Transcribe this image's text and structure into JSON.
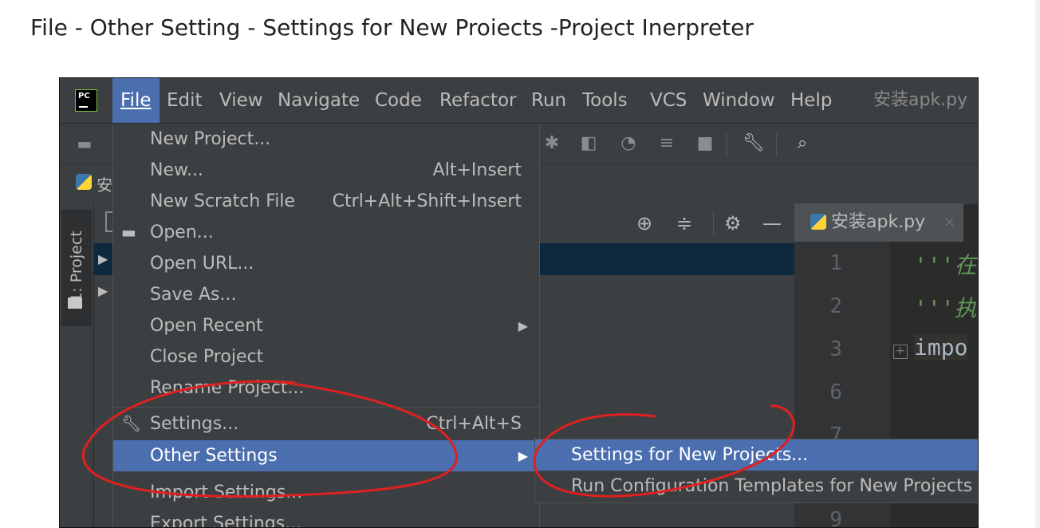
{
  "article": {
    "text": "File - Other Setting - Settings for New Proiects -Project Inerpreter"
  },
  "ide": {
    "logo_text": "PC",
    "window_title": "安装apk.py",
    "menu": [
      {
        "label": "File",
        "active": true
      },
      {
        "label": "Edit"
      },
      {
        "label": "View"
      },
      {
        "label": "Navigate"
      },
      {
        "label": "Code"
      },
      {
        "label": "Refactor"
      },
      {
        "label": "Run"
      },
      {
        "label": "Tools"
      },
      {
        "label": "VCS"
      },
      {
        "label": "Window"
      },
      {
        "label": "Help"
      }
    ],
    "nav_truncated": "安",
    "project_tab_label": "1: Project",
    "editor_tab": {
      "label": "安装apk.py",
      "close": "×"
    },
    "gutter_lines": [
      "1",
      "2",
      "3",
      "6",
      "7",
      "9"
    ],
    "fold_marker": "+",
    "code_lines": [
      "'''在",
      "'''执",
      "impo"
    ],
    "icons": {
      "toolbar": [
        "debug-icon",
        "coverage-icon",
        "profile-icon",
        "concurrency-icon",
        "stop-icon",
        "wrench-icon",
        "search-icon"
      ],
      "panel": [
        "crosshair-icon",
        "collapse-icon",
        "gear-icon",
        "minimize-icon"
      ]
    }
  },
  "file_menu": [
    {
      "label": "New Project...",
      "shortcut": ""
    },
    {
      "label": "New...",
      "shortcut": "Alt+Insert"
    },
    {
      "label": "New Scratch File",
      "shortcut": "Ctrl+Alt+Shift+Insert"
    },
    {
      "label": "Open...",
      "shortcut": "",
      "icon": "folder-icon"
    },
    {
      "label": "Open URL...",
      "shortcut": ""
    },
    {
      "label": "Save As...",
      "shortcut": ""
    },
    {
      "label": "Open Recent",
      "shortcut": "",
      "submenu": true
    },
    {
      "label": "Close Project",
      "shortcut": ""
    },
    {
      "label": "Rename Project...",
      "shortcut": ""
    },
    {
      "label": "Settings...",
      "shortcut": "Ctrl+Alt+S",
      "icon": "wrench-icon"
    },
    {
      "label": "Other Settings",
      "shortcut": "",
      "submenu": true,
      "active": true
    },
    {
      "label": "Import Settings...",
      "shortcut": ""
    },
    {
      "label": "Export Settings...",
      "shortcut": ""
    }
  ],
  "other_settings_submenu": [
    {
      "label": "Settings for New Projects...",
      "active": true
    },
    {
      "label": "Run Configuration Templates for New Projects"
    }
  ],
  "colors": {
    "ide_bg": "#2b2b2b",
    "panel_bg": "#3c3f41",
    "selection": "#4b6eaf",
    "annotation": "#e02020"
  }
}
